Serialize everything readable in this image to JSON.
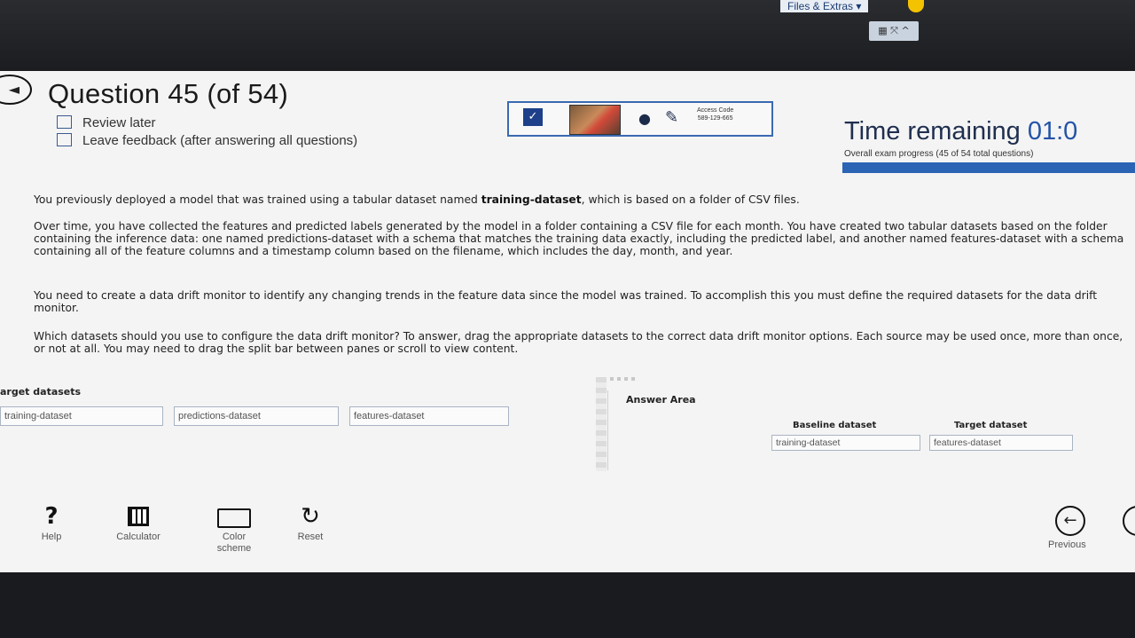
{
  "window": {
    "files_extras": "Files & Extras ▾",
    "window_controls": "▦ ⤧ ^"
  },
  "header": {
    "question_title": "Question 45 (of 54)",
    "review_later": "Review later",
    "leave_feedback": "Leave feedback (after answering all questions)",
    "time_label": "Time remaining",
    "time_value": "01:0",
    "progress_text": "Overall exam progress (45 of 54 total questions)",
    "progress_fraction": 0.83
  },
  "proctor": {
    "access_code_label": "Access Code",
    "access_code": "589-129-665"
  },
  "question": {
    "p1_a": "You previously deployed a model that was trained using a tabular dataset named ",
    "p1_b": "training-dataset",
    "p1_c": ", which is based on a folder of CSV files.",
    "p2": "Over time, you have collected the features and predicted labels generated by the model in a folder containing a CSV file for each month. You have created two tabular datasets based on the folder containing the inference data: one named predictions-dataset with a schema that matches the training data exactly, including the predicted label, and another named features-dataset with a schema containing all of the feature columns and a timestamp column based on the filename, which includes the day, month, and year.",
    "p3": "You need to create a data drift monitor to identify any changing trends in the feature data since the model was trained. To accomplish this you must define the required datasets for the data drift monitor.",
    "p4": "Which datasets should you use to configure the data drift monitor? To answer, drag the appropriate datasets to the correct data drift monitor options. Each source may be used once, more than once, or not at all. You may need to drag the split bar between panes or scroll to view content."
  },
  "drag": {
    "source_label": "arget datasets",
    "sources": [
      "training-dataset",
      "predictions-dataset",
      "features-dataset"
    ],
    "answer_area": "Answer Area",
    "baseline_label": "Baseline dataset",
    "target_label": "Target dataset",
    "baseline_value": "training-dataset",
    "target_value": "features-dataset"
  },
  "tools": {
    "help": "Help",
    "calculator": "Calculator",
    "color_scheme_1": "Color",
    "color_scheme_2": "scheme",
    "reset": "Reset",
    "previous": "Previous"
  }
}
